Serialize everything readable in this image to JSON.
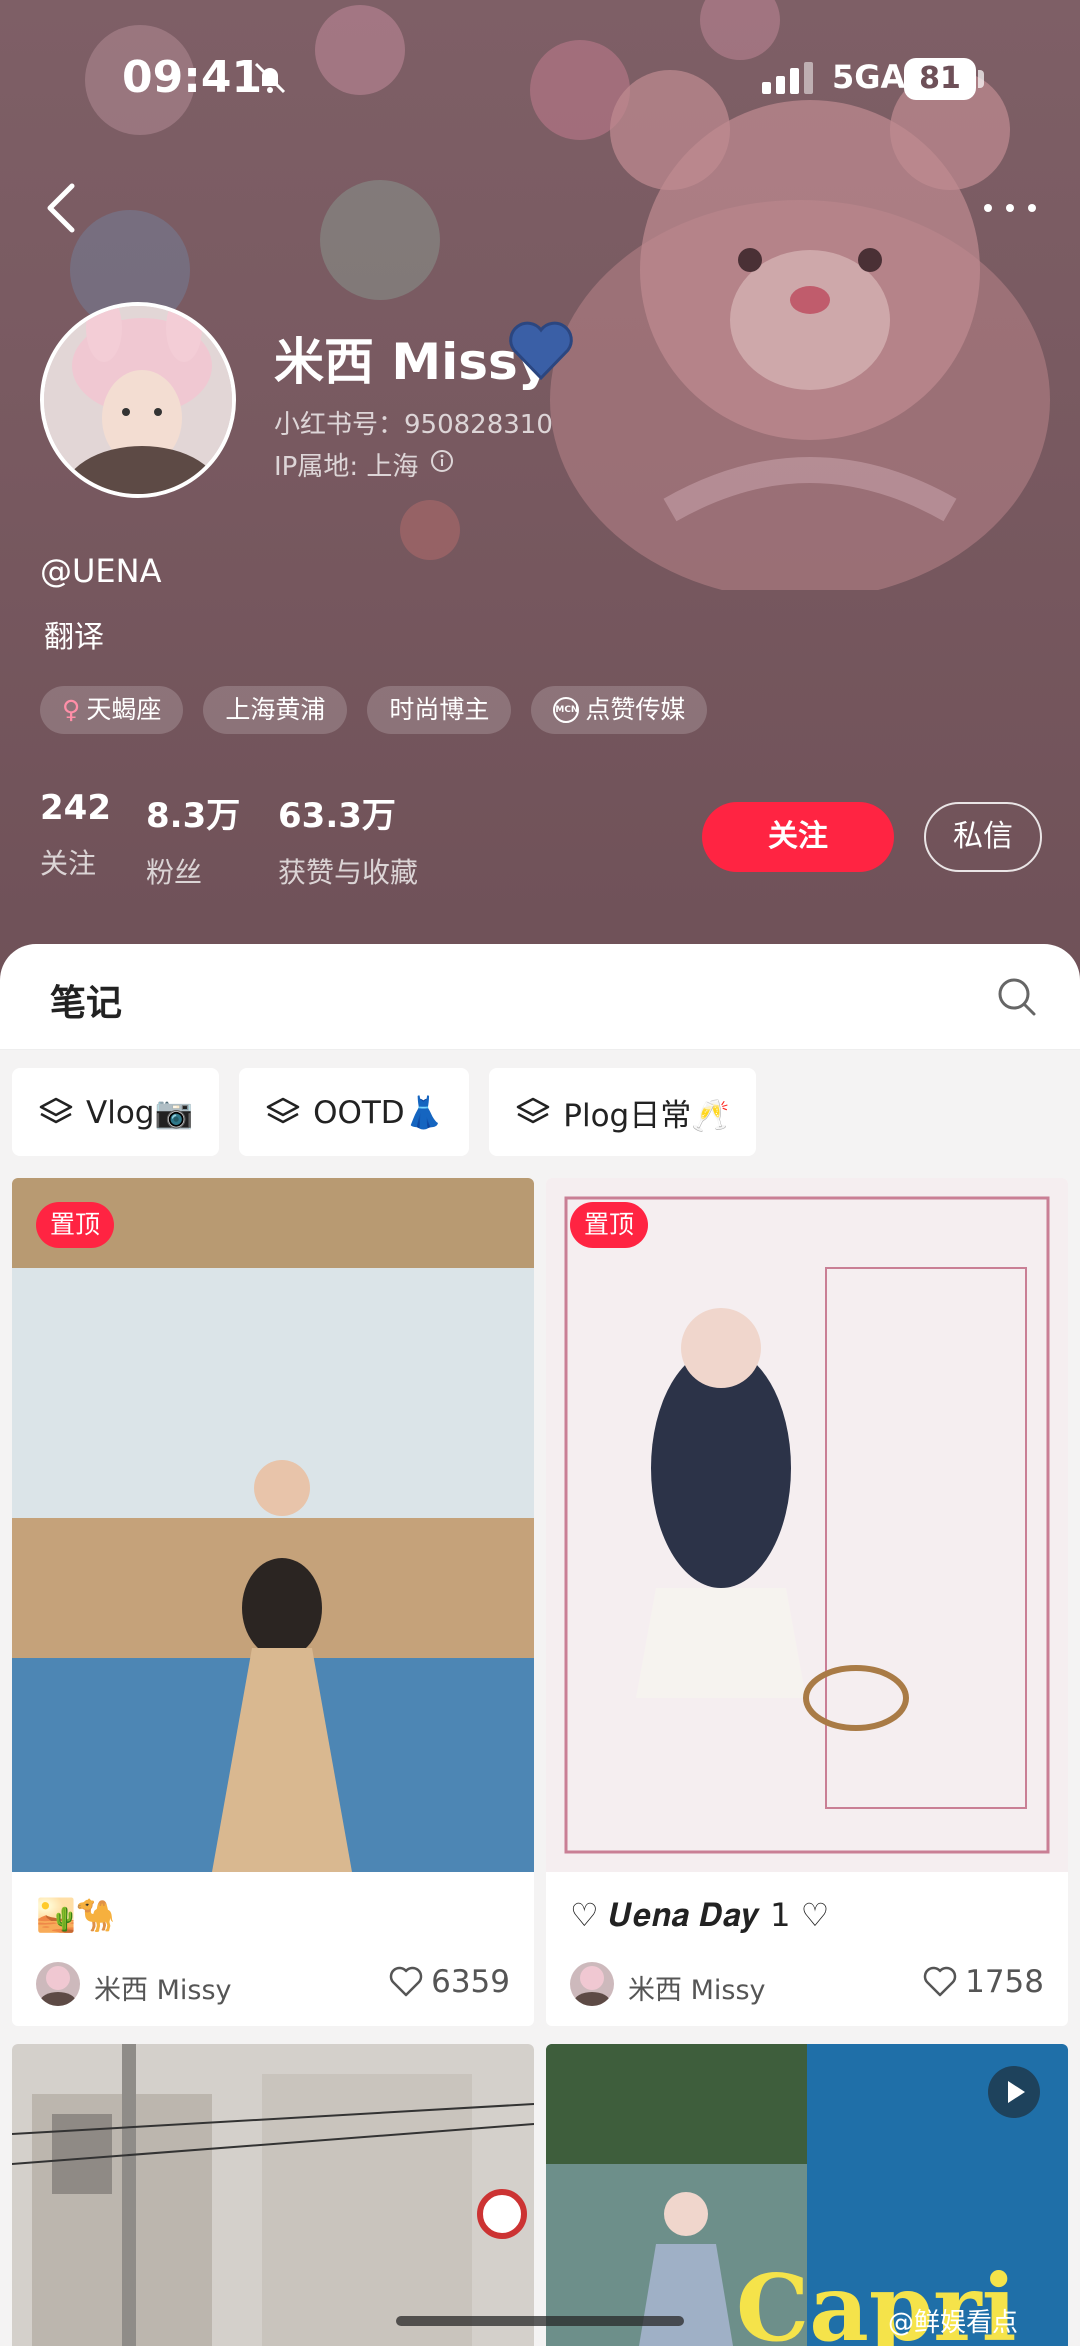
{
  "status_bar": {
    "time": "09:41",
    "network": "5GA",
    "battery": "81"
  },
  "profile": {
    "name": "米西 Missy",
    "red_id": "小红书号：950828310",
    "ip": "IP属地: 上海",
    "handle": "@UENA",
    "description": "翻译",
    "tags": [
      {
        "label": "天蝎座",
        "icon": "female-icon"
      },
      {
        "label": "上海黄浦"
      },
      {
        "label": "时尚博主"
      },
      {
        "label": "点赞传媒",
        "icon": "mcn-icon"
      }
    ],
    "stats": [
      {
        "value": "242",
        "label": "关注"
      },
      {
        "value": "8.3万",
        "label": "粉丝"
      },
      {
        "value": "63.3万",
        "label": "获赞与收藏"
      }
    ],
    "follow_label": "关注",
    "dm_label": "私信"
  },
  "notes": {
    "title": "笔记",
    "collections": [
      {
        "label": "Vlog📷"
      },
      {
        "label": "OOTD👗"
      },
      {
        "label": "Plog日常🥂"
      }
    ],
    "cards": [
      {
        "pin": "置顶",
        "title": "🏜️🐪",
        "author": "米西 Missy",
        "likes": "6359"
      },
      {
        "pin": "置顶",
        "title": "♡ 𝑼𝒆𝒏𝒂 𝑫𝒂𝒚 1 ♡",
        "author": "米西 Missy",
        "likes": "1758"
      },
      {
        "title": "",
        "author": "",
        "likes": ""
      },
      {
        "cover_text": "Capri"
      }
    ]
  },
  "watermark": "@鲜娱看点",
  "colors": {
    "brand_red": "#ff2442",
    "header_bg": "#7b5c63"
  }
}
